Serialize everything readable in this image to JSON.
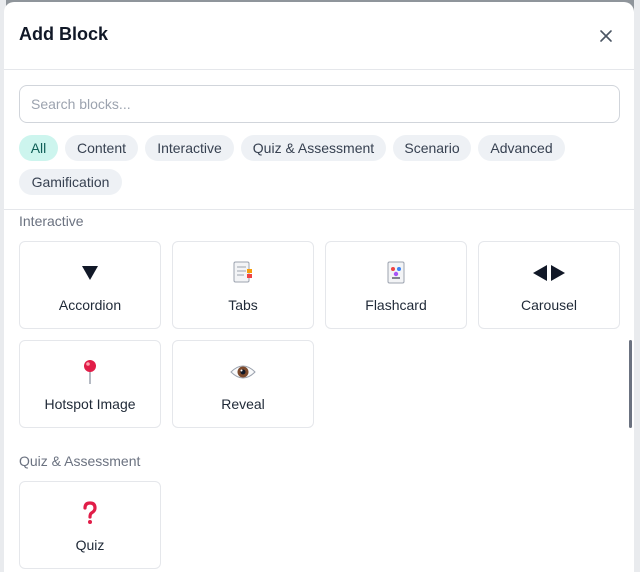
{
  "modal": {
    "title": "Add Block",
    "close_icon": "close-icon"
  },
  "search": {
    "placeholder": "Search blocks...",
    "value": ""
  },
  "filters": [
    {
      "label": "All",
      "active": true
    },
    {
      "label": "Content",
      "active": false
    },
    {
      "label": "Interactive",
      "active": false
    },
    {
      "label": "Quiz & Assessment",
      "active": false
    },
    {
      "label": "Scenario",
      "active": false
    },
    {
      "label": "Advanced",
      "active": false
    },
    {
      "label": "Gamification",
      "active": false
    }
  ],
  "sections": [
    {
      "title": "Interactive",
      "blocks": [
        {
          "label": "Accordion",
          "icon": "accordion-triangle-icon"
        },
        {
          "label": "Tabs",
          "icon": "tabs-document-icon"
        },
        {
          "label": "Flashcard",
          "icon": "flashcard-icon"
        },
        {
          "label": "Carousel",
          "icon": "carousel-arrows-icon"
        },
        {
          "label": "Hotspot Image",
          "icon": "pin-icon"
        },
        {
          "label": "Reveal",
          "icon": "eye-icon"
        }
      ]
    },
    {
      "title": "Quiz & Assessment",
      "blocks": [
        {
          "label": "Quiz",
          "icon": "question-mark-icon"
        }
      ]
    }
  ],
  "colors": {
    "active_chip_bg": "#cdf5ee",
    "chip_bg": "#eef1f5",
    "pin_red": "#e11d48",
    "quiz_red": "#e11d48"
  }
}
